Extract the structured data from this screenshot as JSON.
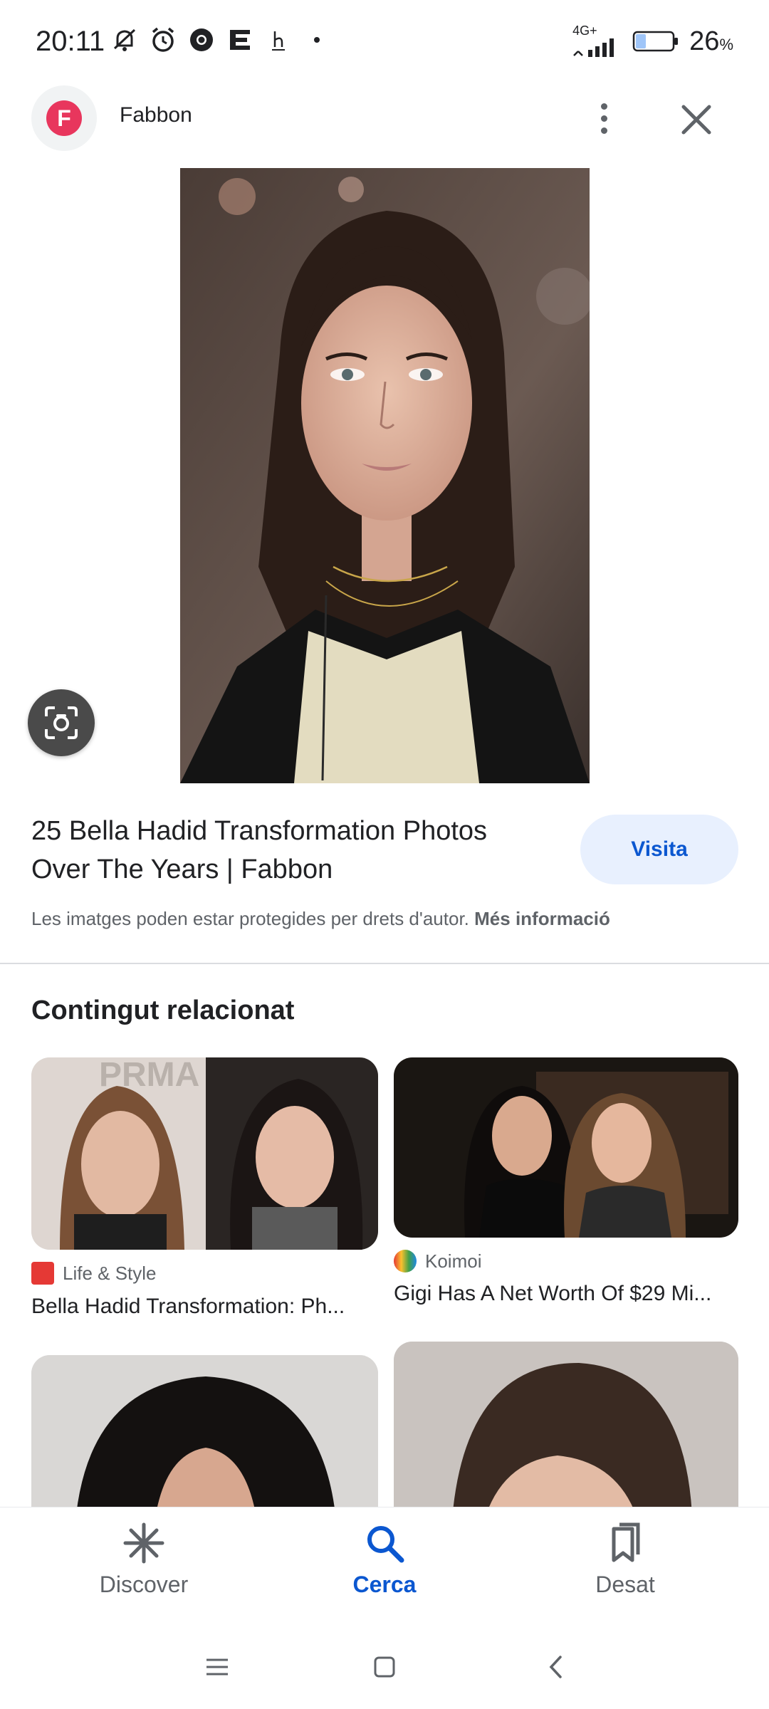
{
  "status_bar": {
    "time": "20:11",
    "network": "4G+",
    "battery": "26",
    "battery_unit": "%"
  },
  "header": {
    "site_initial": "F",
    "site_name": "Fabbon",
    "icons": [
      "more-vert-icon",
      "close-icon"
    ]
  },
  "result": {
    "title": "25 Bella Hadid Transformation Photos Over The Years | Fabbon",
    "visit_label": "Visita",
    "copyright_text": "Les imatges poden estar protegides per drets d'autor.",
    "more_info_label": "Més informació"
  },
  "related": {
    "heading": "Contingut relacionat",
    "cards": [
      {
        "source": "Life & Style",
        "title": "Bella Hadid Transformation: Ph..."
      },
      {
        "source": "Koimoi",
        "title": "Gigi Has A Net Worth Of $29 Mi..."
      }
    ]
  },
  "bottom_nav": {
    "items": [
      {
        "label": "Discover",
        "icon": "asterisk-icon",
        "active": false
      },
      {
        "label": "Cerca",
        "icon": "search-icon",
        "active": true
      },
      {
        "label": "Desat",
        "icon": "bookmarks-icon",
        "active": false
      }
    ]
  },
  "colors": {
    "accent": "#0b57d0",
    "visit_bg": "#e8f0fe",
    "brand": "#e8365d"
  }
}
